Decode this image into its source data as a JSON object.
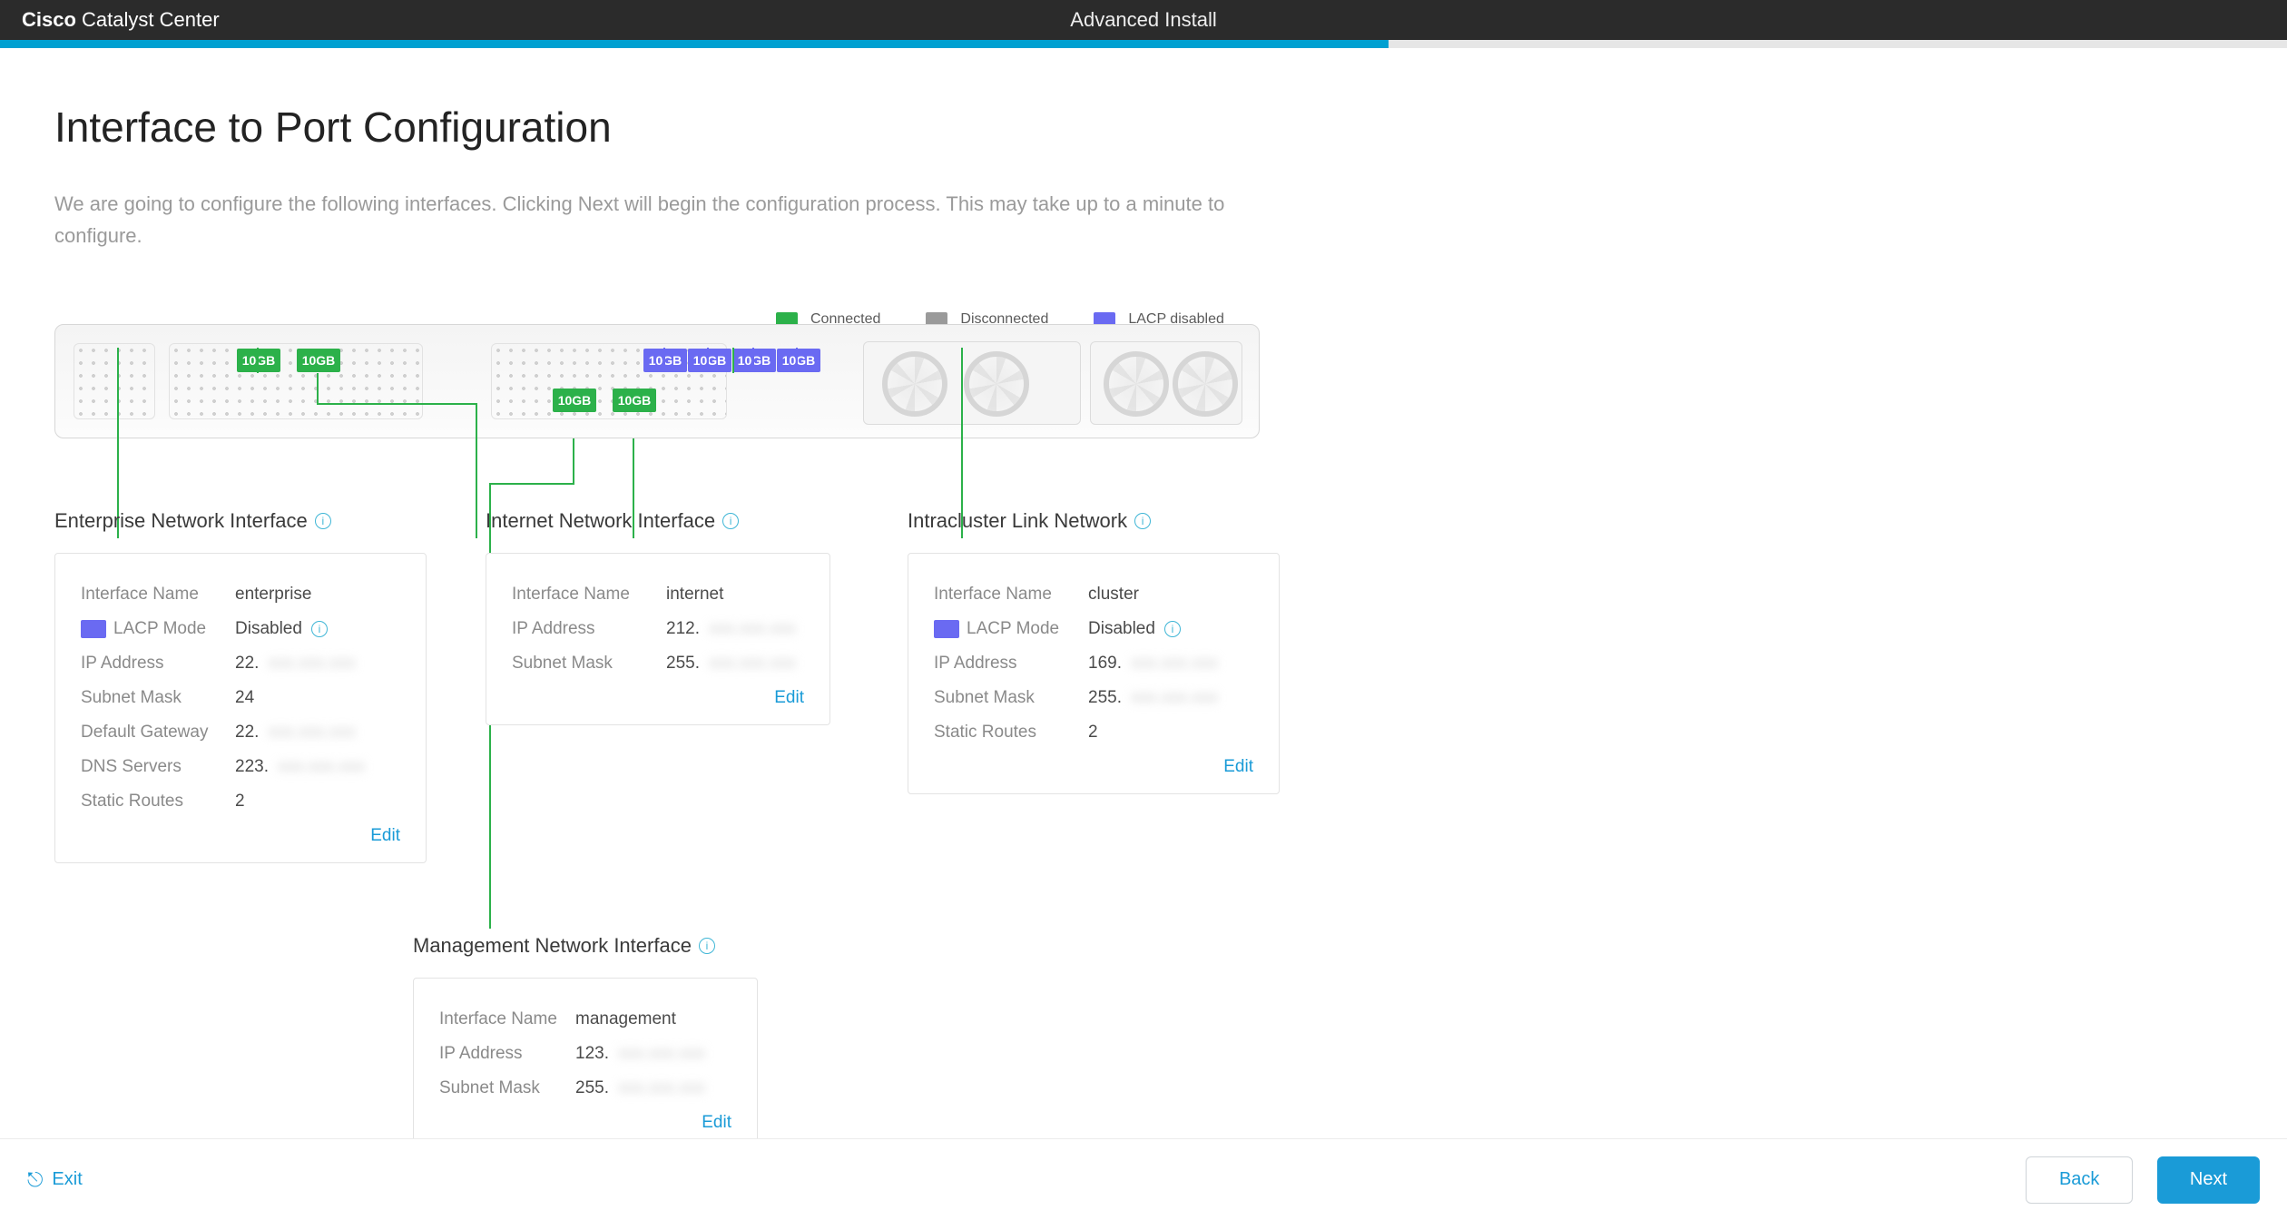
{
  "header": {
    "brand_cisco": "Cisco",
    "brand_rest": "Catalyst Center",
    "title": "Advanced Install"
  },
  "progress": {
    "percent": 60.7
  },
  "page": {
    "heading": "Interface to Port Configuration",
    "description": "We are going to configure the following interfaces. Clicking Next will begin the configuration process. This may take up to a minute to configure."
  },
  "legend": {
    "connected": "Connected",
    "disconnected": "Disconnected",
    "lacp_disabled": "LACP disabled"
  },
  "port_label": "10GB",
  "labels": {
    "interface_name": "Interface Name",
    "lacp_mode": "LACP Mode",
    "ip_address": "IP Address",
    "subnet_mask": "Subnet Mask",
    "default_gateway": "Default Gateway",
    "dns_servers": "DNS Servers",
    "static_routes": "Static Routes",
    "edit": "Edit"
  },
  "enterprise": {
    "title": "Enterprise Network Interface",
    "interface_name": "enterprise",
    "lacp_mode": "Disabled",
    "ip_prefix": "22.",
    "subnet_mask": "24",
    "gateway_prefix": "22.",
    "dns_prefix": "223.",
    "static_routes": "2"
  },
  "internet": {
    "title": "Internet Network Interface",
    "interface_name": "internet",
    "ip_prefix": "212.",
    "subnet_prefix": "255."
  },
  "intracluster": {
    "title": "Intracluster Link Network",
    "interface_name": "cluster",
    "lacp_mode": "Disabled",
    "ip_prefix": "169.",
    "subnet_prefix": "255.",
    "static_routes": "2"
  },
  "management": {
    "title": "Management Network Interface",
    "interface_name": "management",
    "ip_prefix": "123.",
    "subnet_prefix": "255."
  },
  "footer": {
    "exit": "Exit",
    "back": "Back",
    "next": "Next"
  }
}
